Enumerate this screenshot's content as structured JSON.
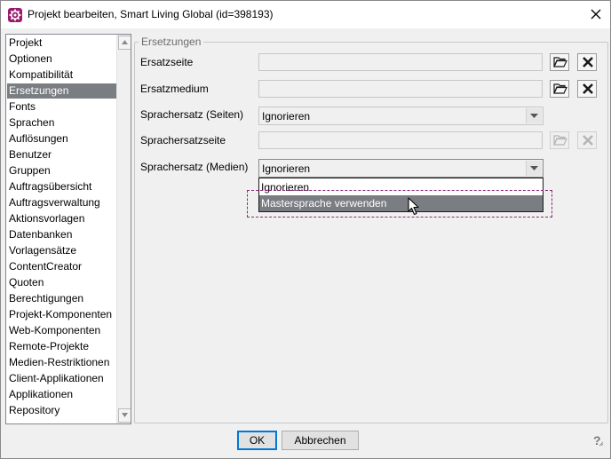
{
  "window": {
    "title": "Projekt bearbeiten, Smart Living Global (id=398193)"
  },
  "sidebar": {
    "selected_index": 4,
    "items": [
      {
        "label": "Projekt"
      },
      {
        "label": "Optionen"
      },
      {
        "label": "Kompatibilität"
      },
      {
        "label": "Ersetzungen"
      },
      {
        "label": "Fonts"
      },
      {
        "label": "Sprachen"
      },
      {
        "label": "Auflösungen"
      },
      {
        "label": "Benutzer"
      },
      {
        "label": "Gruppen"
      },
      {
        "label": "Auftragsübersicht"
      },
      {
        "label": "Auftragsverwaltung"
      },
      {
        "label": "Aktionsvorlagen"
      },
      {
        "label": "Datenbanken"
      },
      {
        "label": "Vorlagensätze"
      },
      {
        "label": "ContentCreator"
      },
      {
        "label": "Quoten"
      },
      {
        "label": "Berechtigungen"
      },
      {
        "label": "Projekt-Komponenten"
      },
      {
        "label": "Web-Komponenten"
      },
      {
        "label": "Remote-Projekte"
      },
      {
        "label": "Medien-Restriktionen"
      },
      {
        "label": "Client-Applikationen"
      },
      {
        "label": "Applikationen"
      },
      {
        "label": "Repository"
      }
    ]
  },
  "group": {
    "title": "Ersetzungen"
  },
  "form": {
    "ersatzseite": {
      "label": "Ersatzseite",
      "value": ""
    },
    "ersatzmedium": {
      "label": "Ersatzmedium",
      "value": ""
    },
    "sprachersatz_seiten": {
      "label": "Sprachersatz (Seiten)",
      "value": "Ignorieren"
    },
    "sprachersatzseite": {
      "label": "Sprachersatzseite",
      "value": ""
    },
    "sprachersatz_medien": {
      "label": "Sprachersatz (Medien)",
      "value": "Ignorieren"
    }
  },
  "dropdown": {
    "options": [
      {
        "label": "Ignorieren"
      },
      {
        "label": "Mastersprache verwenden"
      }
    ],
    "highlighted_index": 1
  },
  "footer": {
    "ok_label": "OK",
    "cancel_label": "Abbrechen",
    "help_label": "?"
  },
  "colors": {
    "accent": "#9a1a6e",
    "selection": "#7a7d82",
    "delete_icon": "#1a1a1a",
    "callout": "#8e2a78"
  }
}
